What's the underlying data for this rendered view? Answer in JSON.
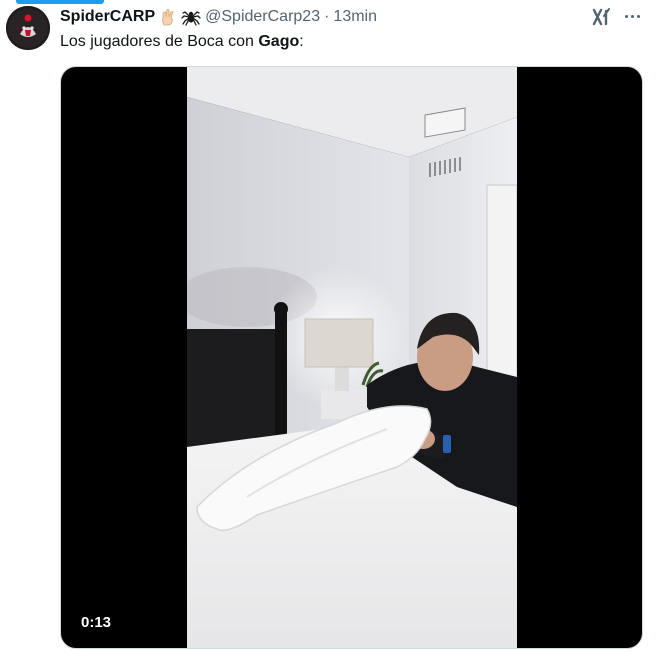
{
  "tweet": {
    "display_name": "SpiderCARP",
    "handle": "@SpiderCarp23",
    "separator": "·",
    "time": "13min",
    "text_prefix": "Los jugadores de Boca con ",
    "text_bold": "Gago",
    "text_suffix": ":"
  },
  "icons": {
    "avatar": "avatar-image",
    "emoji_1": "fingers-crossed-icon",
    "emoji_2": "spider-icon",
    "grok": "grok-icon",
    "more": "more-icon"
  },
  "media": {
    "type": "video",
    "duration": "0:13"
  },
  "colors": {
    "accent": "#1d9bf0",
    "secondary_text": "#536471",
    "text": "#0f1419",
    "media_bg": "#000000"
  }
}
